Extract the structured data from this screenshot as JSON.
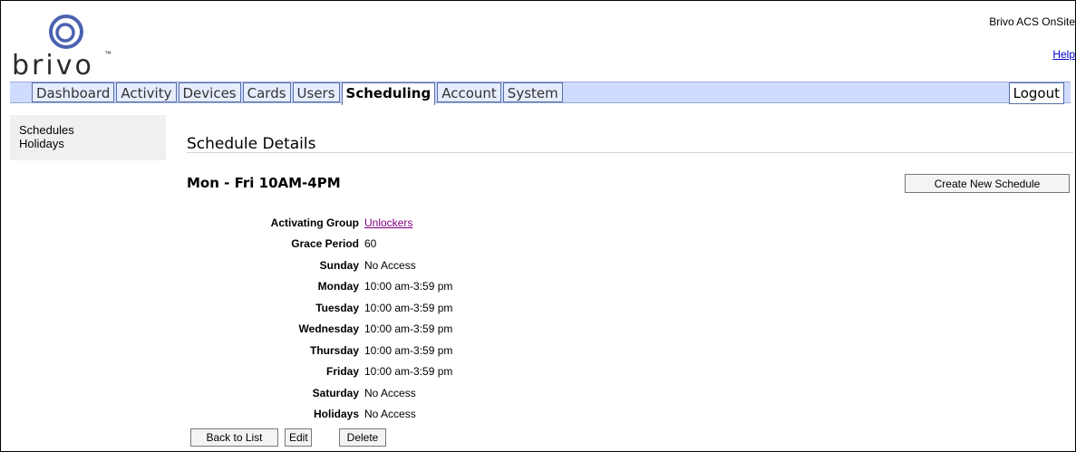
{
  "header": {
    "logo_text": "brivo",
    "logo_tm": "™",
    "app_title": "Brivo ACS OnSite",
    "help_link": "Help"
  },
  "nav": {
    "tabs": [
      {
        "label": "Dashboard",
        "active": false
      },
      {
        "label": "Activity",
        "active": false
      },
      {
        "label": "Devices",
        "active": false
      },
      {
        "label": "Cards",
        "active": false
      },
      {
        "label": "Users",
        "active": false
      },
      {
        "label": "Scheduling",
        "active": true
      },
      {
        "label": "Account",
        "active": false
      },
      {
        "label": "System",
        "active": false
      }
    ],
    "logout_label": "Logout"
  },
  "sidebar": {
    "items": [
      {
        "label": "Schedules"
      },
      {
        "label": "Holidays"
      }
    ]
  },
  "main": {
    "page_title": "Schedule Details",
    "schedule_name": "Mon - Fri 10AM-4PM",
    "create_button": "Create New Schedule",
    "details": [
      {
        "label": "Activating Group",
        "value": "Unlockers",
        "is_link": true
      },
      {
        "label": "Grace Period",
        "value": "60"
      },
      {
        "label": "Sunday",
        "value": "No Access"
      },
      {
        "label": "Monday",
        "value": "10:00 am-3:59 pm"
      },
      {
        "label": "Tuesday",
        "value": "10:00 am-3:59 pm"
      },
      {
        "label": "Wednesday",
        "value": "10:00 am-3:59 pm"
      },
      {
        "label": "Thursday",
        "value": "10:00 am-3:59 pm"
      },
      {
        "label": "Friday",
        "value": "10:00 am-3:59 pm"
      },
      {
        "label": "Saturday",
        "value": "No Access"
      },
      {
        "label": "Holidays",
        "value": "No Access"
      }
    ],
    "actions": {
      "back": "Back to List",
      "edit": "Edit",
      "delete": "Delete"
    }
  },
  "colors": {
    "nav_bar": "#cfdcff",
    "link_visited": "#800080",
    "help_link": "#0000cc"
  }
}
